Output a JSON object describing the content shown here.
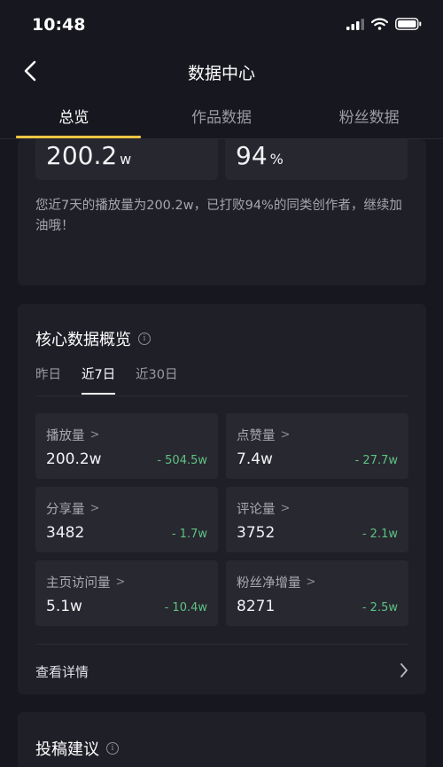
{
  "status_bar": {
    "time": "10:48",
    "icons": [
      "signal-icon",
      "wifi-icon",
      "battery-icon"
    ]
  },
  "nav": {
    "title": "数据中心",
    "back_icon": "chevron-left-icon"
  },
  "tabs": [
    {
      "label": "总览",
      "active": true
    },
    {
      "label": "作品数据",
      "active": false
    },
    {
      "label": "粉丝数据",
      "active": false
    }
  ],
  "summary": {
    "play_value": "200.2",
    "play_unit": "w",
    "beat_value": "94",
    "beat_unit": "%",
    "text": "您近7天的播放量为200.2w，已打败94%的同类创作者，继续加油哦！"
  },
  "core": {
    "title": "核心数据概览",
    "periods": [
      "昨日",
      "近7日",
      "近30日"
    ],
    "active_period": "近7日",
    "metrics": [
      {
        "label": "播放量",
        "value": "200.2w",
        "delta": "- 504.5w"
      },
      {
        "label": "点赞量",
        "value": "7.4w",
        "delta": "- 27.7w"
      },
      {
        "label": "分享量",
        "value": "3482",
        "delta": "- 1.7w"
      },
      {
        "label": "评论量",
        "value": "3752",
        "delta": "- 2.1w"
      },
      {
        "label": "主页访问量",
        "value": "5.1w",
        "delta": "- 10.4w"
      },
      {
        "label": "粉丝净增量",
        "value": "8271",
        "delta": "- 2.5w"
      }
    ],
    "detail_label": "查看详情"
  },
  "post": {
    "title": "投稿建议"
  },
  "colors": {
    "background": "#17171f",
    "card": "#1f1f28",
    "tab_indicator": "#f1c542",
    "delta": "#5ec280"
  }
}
